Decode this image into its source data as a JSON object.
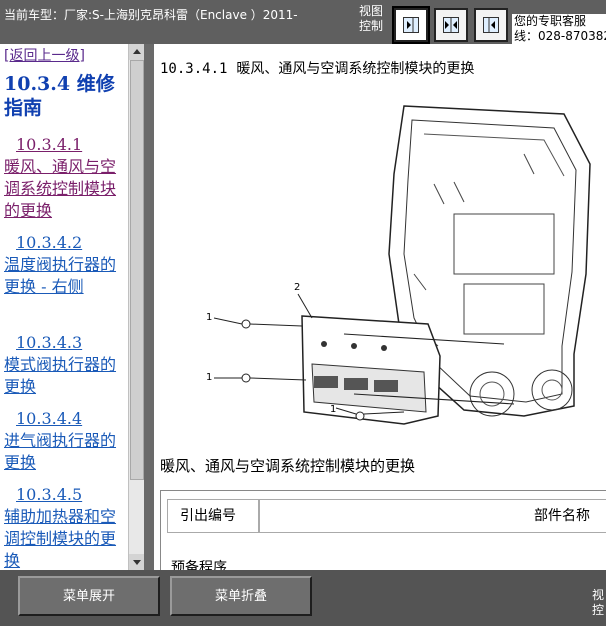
{
  "topbar": {
    "car_info": "当前车型：厂家:S-上海别克昂科雷（Enclave ）2011-",
    "view_control_label": "视图控制",
    "support_line1": "您的专职客服",
    "support_line2": "线：028-870382"
  },
  "sidebar": {
    "back_link": "[返回上一级]",
    "title": "10.3.4 维修指南",
    "items": [
      {
        "num": "10.3.4.1",
        "text": "暖风、通风与空调系统控制模块的更换"
      },
      {
        "num": "10.3.4.2",
        "text": "温度阀执行器的更换 - 右侧"
      },
      {
        "num": "10.3.4.3",
        "text": "模式阀执行器的更换"
      },
      {
        "num": "10.3.4.4",
        "text": "进气阀执行器的更换"
      },
      {
        "num": "10.3.4.5",
        "text": "辅助加热器和空调控制模块的更换"
      }
    ]
  },
  "content": {
    "section_number": "10.3.4.1",
    "section_title": "暖风、通风与空调系统控制模块的更换",
    "figure_callouts": [
      "2",
      "1",
      "1",
      "1"
    ],
    "figure_caption": "暖风、通风与空调系统控制模块的更换",
    "table_header": [
      "引出编号",
      "部件名称"
    ],
    "table_row_label": "预备程序"
  },
  "bottombar": {
    "expand_label": "菜单展开",
    "collapse_label": "菜单折叠",
    "view_label": "视控"
  }
}
